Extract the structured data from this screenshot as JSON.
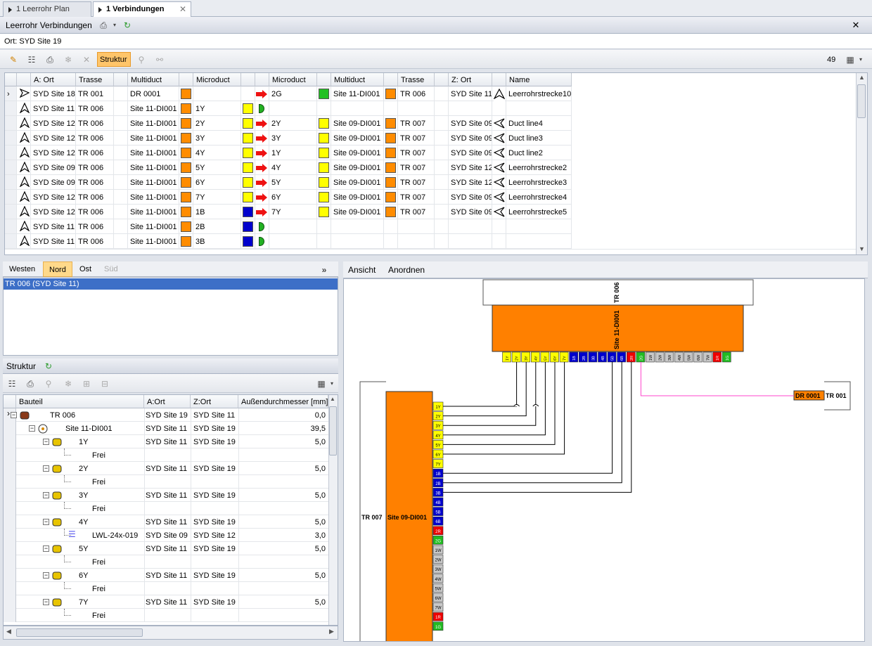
{
  "tabs": [
    {
      "label": "1 Leerrohr Plan"
    },
    {
      "label": "1 Verbindungen"
    }
  ],
  "panel_title": "Leerrohr Verbindungen",
  "location": "Ort:  SYD Site 19",
  "structure_btn": "Struktur",
  "count": "49",
  "columns": [
    "A: Ort",
    "Trasse",
    "Multiduct",
    "Microduct",
    "Microduct",
    "Multiduct",
    "Trasse",
    "Z: Ort",
    "Name"
  ],
  "rows": [
    {
      "a": "SYD Site 18",
      "t1": "TR 001",
      "m1": "DR 0001",
      "c1": "#ff8c00",
      "u1": "",
      "c2": "",
      "arrow": true,
      "u2": "2G",
      "c3": "#22c022",
      "m2": "Site 11-DI001",
      "c4": "#ff8c00",
      "t2": "TR 006",
      "z": "SYD Site 11",
      "name": "Leerrohrstrecke10"
    },
    {
      "a": "SYD Site 11",
      "t1": "TR 006",
      "m1": "Site 11-DI001",
      "c1": "#ff8c00",
      "u1": "1Y",
      "c2": "#ffff00",
      "arrow": false,
      "u2": "",
      "c3": "",
      "m2": "",
      "c4": "",
      "t2": "",
      "z": "",
      "name": ""
    },
    {
      "a": "SYD Site 12",
      "t1": "TR 006",
      "m1": "Site 11-DI001",
      "c1": "#ff8c00",
      "u1": "2Y",
      "c2": "#ffff00",
      "arrow": true,
      "u2": "2Y",
      "c3": "#ffff00",
      "m2": "Site 09-DI001",
      "c4": "#ff8c00",
      "t2": "TR 007",
      "z": "SYD Site 09",
      "name": "Duct line4"
    },
    {
      "a": "SYD Site 12",
      "t1": "TR 006",
      "m1": "Site 11-DI001",
      "c1": "#ff8c00",
      "u1": "3Y",
      "c2": "#ffff00",
      "arrow": true,
      "u2": "3Y",
      "c3": "#ffff00",
      "m2": "Site 09-DI001",
      "c4": "#ff8c00",
      "t2": "TR 007",
      "z": "SYD Site 09",
      "name": "Duct line3"
    },
    {
      "a": "SYD Site 12",
      "t1": "TR 006",
      "m1": "Site 11-DI001",
      "c1": "#ff8c00",
      "u1": "4Y",
      "c2": "#ffff00",
      "arrow": true,
      "u2": "1Y",
      "c3": "#ffff00",
      "m2": "Site 09-DI001",
      "c4": "#ff8c00",
      "t2": "TR 007",
      "z": "SYD Site 09",
      "name": "Duct line2"
    },
    {
      "a": "SYD Site 09",
      "t1": "TR 006",
      "m1": "Site 11-DI001",
      "c1": "#ff8c00",
      "u1": "5Y",
      "c2": "#ffff00",
      "arrow": true,
      "u2": "4Y",
      "c3": "#ffff00",
      "m2": "Site 09-DI001",
      "c4": "#ff8c00",
      "t2": "TR 007",
      "z": "SYD Site 12",
      "name": "Leerrohrstrecke2"
    },
    {
      "a": "SYD Site 09",
      "t1": "TR 006",
      "m1": "Site 11-DI001",
      "c1": "#ff8c00",
      "u1": "6Y",
      "c2": "#ffff00",
      "arrow": true,
      "u2": "5Y",
      "c3": "#ffff00",
      "m2": "Site 09-DI001",
      "c4": "#ff8c00",
      "t2": "TR 007",
      "z": "SYD Site 12",
      "name": "Leerrohrstrecke3"
    },
    {
      "a": "SYD Site 12",
      "t1": "TR 006",
      "m1": "Site 11-DI001",
      "c1": "#ff8c00",
      "u1": "7Y",
      "c2": "#ffff00",
      "arrow": true,
      "u2": "6Y",
      "c3": "#ffff00",
      "m2": "Site 09-DI001",
      "c4": "#ff8c00",
      "t2": "TR 007",
      "z": "SYD Site 09",
      "name": "Leerrohrstrecke4"
    },
    {
      "a": "SYD Site 12",
      "t1": "TR 006",
      "m1": "Site 11-DI001",
      "c1": "#ff8c00",
      "u1": "1B",
      "c2": "#0000cc",
      "arrow": true,
      "u2": "7Y",
      "c3": "#ffff00",
      "m2": "Site 09-DI001",
      "c4": "#ff8c00",
      "t2": "TR 007",
      "z": "SYD Site 09",
      "name": "Leerrohrstrecke5"
    },
    {
      "a": "SYD Site 11",
      "t1": "TR 006",
      "m1": "Site 11-DI001",
      "c1": "#ff8c00",
      "u1": "2B",
      "c2": "#0000cc",
      "arrow": false,
      "u2": "",
      "c3": "",
      "m2": "",
      "c4": "",
      "t2": "",
      "z": "",
      "name": ""
    },
    {
      "a": "SYD Site 11",
      "t1": "TR 006",
      "m1": "Site 11-DI001",
      "c1": "#ff8c00",
      "u1": "3B",
      "c2": "#0000cc",
      "arrow": false,
      "u2": "",
      "c3": "",
      "m2": "",
      "c4": "",
      "t2": "",
      "z": "",
      "name": ""
    }
  ],
  "direction_tabs": [
    "Westen",
    "Nord",
    "Ost",
    "Süd"
  ],
  "direction_list": [
    "TR 006 (SYD Site 11)"
  ],
  "struktur_title": "Struktur",
  "tree_columns": [
    "Bauteil",
    "A:Ort",
    "Z:Ort",
    "Außendurchmesser [mm]"
  ],
  "tree_rows": [
    {
      "level": 0,
      "label": "TR 006",
      "a": "SYD Site 19",
      "z": "SYD Site 11",
      "d": "0,0"
    },
    {
      "level": 1,
      "label": "Site 11-DI001",
      "a": "SYD Site 11",
      "z": "SYD Site 19",
      "d": "39,5"
    },
    {
      "level": 2,
      "label": "1Y",
      "a": "SYD Site 11",
      "z": "SYD Site 19",
      "d": "5,0"
    },
    {
      "level": 3,
      "label": "Frei",
      "a": "",
      "z": "",
      "d": ""
    },
    {
      "level": 2,
      "label": "2Y",
      "a": "SYD Site 11",
      "z": "SYD Site 19",
      "d": "5,0"
    },
    {
      "level": 3,
      "label": "Frei",
      "a": "",
      "z": "",
      "d": ""
    },
    {
      "level": 2,
      "label": "3Y",
      "a": "SYD Site 11",
      "z": "SYD Site 19",
      "d": "5,0"
    },
    {
      "level": 3,
      "label": "Frei",
      "a": "",
      "z": "",
      "d": ""
    },
    {
      "level": 2,
      "label": "4Y",
      "a": "SYD Site 11",
      "z": "SYD Site 19",
      "d": "5,0"
    },
    {
      "level": 3,
      "label": "LWL-24x-019",
      "a": "SYD Site 09",
      "z": "SYD Site 12",
      "d": "3,0"
    },
    {
      "level": 2,
      "label": "5Y",
      "a": "SYD Site 11",
      "z": "SYD Site 19",
      "d": "5,0"
    },
    {
      "level": 3,
      "label": "Frei",
      "a": "",
      "z": "",
      "d": ""
    },
    {
      "level": 2,
      "label": "6Y",
      "a": "SYD Site 11",
      "z": "SYD Site 19",
      "d": "5,0"
    },
    {
      "level": 3,
      "label": "Frei",
      "a": "",
      "z": "",
      "d": ""
    },
    {
      "level": 2,
      "label": "7Y",
      "a": "SYD Site 11",
      "z": "SYD Site 19",
      "d": "5,0"
    },
    {
      "level": 3,
      "label": "Frei",
      "a": "",
      "z": "",
      "d": ""
    }
  ],
  "diagram_menu": [
    "Ansicht",
    "Anordnen"
  ],
  "diagram": {
    "top_trasse": "TR 006",
    "top_multiduct": "Site 11-DI001",
    "left_trasse": "TR 007",
    "left_multiduct": "Site 09-DI001",
    "right_multiduct": "DR 0001",
    "right_trasse": "TR 001",
    "top_ports": [
      {
        "l": "1Y",
        "c": "#ffff00"
      },
      {
        "l": "2Y",
        "c": "#ffff00"
      },
      {
        "l": "3Y",
        "c": "#ffff00"
      },
      {
        "l": "4Y",
        "c": "#ffff00"
      },
      {
        "l": "5Y",
        "c": "#ffff00"
      },
      {
        "l": "6Y",
        "c": "#ffff00"
      },
      {
        "l": "7Y",
        "c": "#ffff00"
      },
      {
        "l": "1B",
        "c": "#0000cc"
      },
      {
        "l": "2B",
        "c": "#0000cc"
      },
      {
        "l": "3B",
        "c": "#0000cc"
      },
      {
        "l": "4B",
        "c": "#0000cc"
      },
      {
        "l": "5B",
        "c": "#0000cc"
      },
      {
        "l": "6B",
        "c": "#0000cc"
      },
      {
        "l": "2R",
        "c": "#ee0000"
      },
      {
        "l": "2G",
        "c": "#22bb22"
      },
      {
        "l": "1W",
        "c": "#c8c8c8"
      },
      {
        "l": "2W",
        "c": "#c8c8c8"
      },
      {
        "l": "3W",
        "c": "#c8c8c8"
      },
      {
        "l": "4W",
        "c": "#c8c8c8"
      },
      {
        "l": "5W",
        "c": "#c8c8c8"
      },
      {
        "l": "6W",
        "c": "#c8c8c8"
      },
      {
        "l": "7W",
        "c": "#c8c8c8"
      },
      {
        "l": "1R",
        "c": "#ee0000"
      },
      {
        "l": "1G",
        "c": "#22bb22"
      }
    ],
    "left_ports": [
      {
        "l": "1Y",
        "c": "#ffff00"
      },
      {
        "l": "2Y",
        "c": "#ffff00"
      },
      {
        "l": "3Y",
        "c": "#ffff00"
      },
      {
        "l": "4Y",
        "c": "#ffff00"
      },
      {
        "l": "5Y",
        "c": "#ffff00"
      },
      {
        "l": "6Y",
        "c": "#ffff00"
      },
      {
        "l": "7Y",
        "c": "#ffff00"
      },
      {
        "l": "1B",
        "c": "#0000cc"
      },
      {
        "l": "2B",
        "c": "#0000cc"
      },
      {
        "l": "3B",
        "c": "#0000cc"
      },
      {
        "l": "4B",
        "c": "#0000cc"
      },
      {
        "l": "5B",
        "c": "#0000cc"
      },
      {
        "l": "6B",
        "c": "#0000cc"
      },
      {
        "l": "2R",
        "c": "#ee0000"
      },
      {
        "l": "2G",
        "c": "#22bb22"
      },
      {
        "l": "1W",
        "c": "#c8c8c8"
      },
      {
        "l": "2W",
        "c": "#c8c8c8"
      },
      {
        "l": "3W",
        "c": "#c8c8c8"
      },
      {
        "l": "4W",
        "c": "#c8c8c8"
      },
      {
        "l": "5W",
        "c": "#c8c8c8"
      },
      {
        "l": "6W",
        "c": "#c8c8c8"
      },
      {
        "l": "7W",
        "c": "#c8c8c8"
      },
      {
        "l": "1R",
        "c": "#ee0000"
      },
      {
        "l": "1G",
        "c": "#22bb22"
      }
    ],
    "connections": [
      [
        1,
        0
      ],
      [
        2,
        1
      ],
      [
        3,
        2
      ],
      [
        4,
        3
      ],
      [
        5,
        4
      ],
      [
        6,
        5
      ],
      [
        11,
        7
      ],
      [
        12,
        8
      ],
      [
        13,
        9
      ]
    ],
    "orange": "#ff8000",
    "pink_line": "#ff44cc"
  }
}
